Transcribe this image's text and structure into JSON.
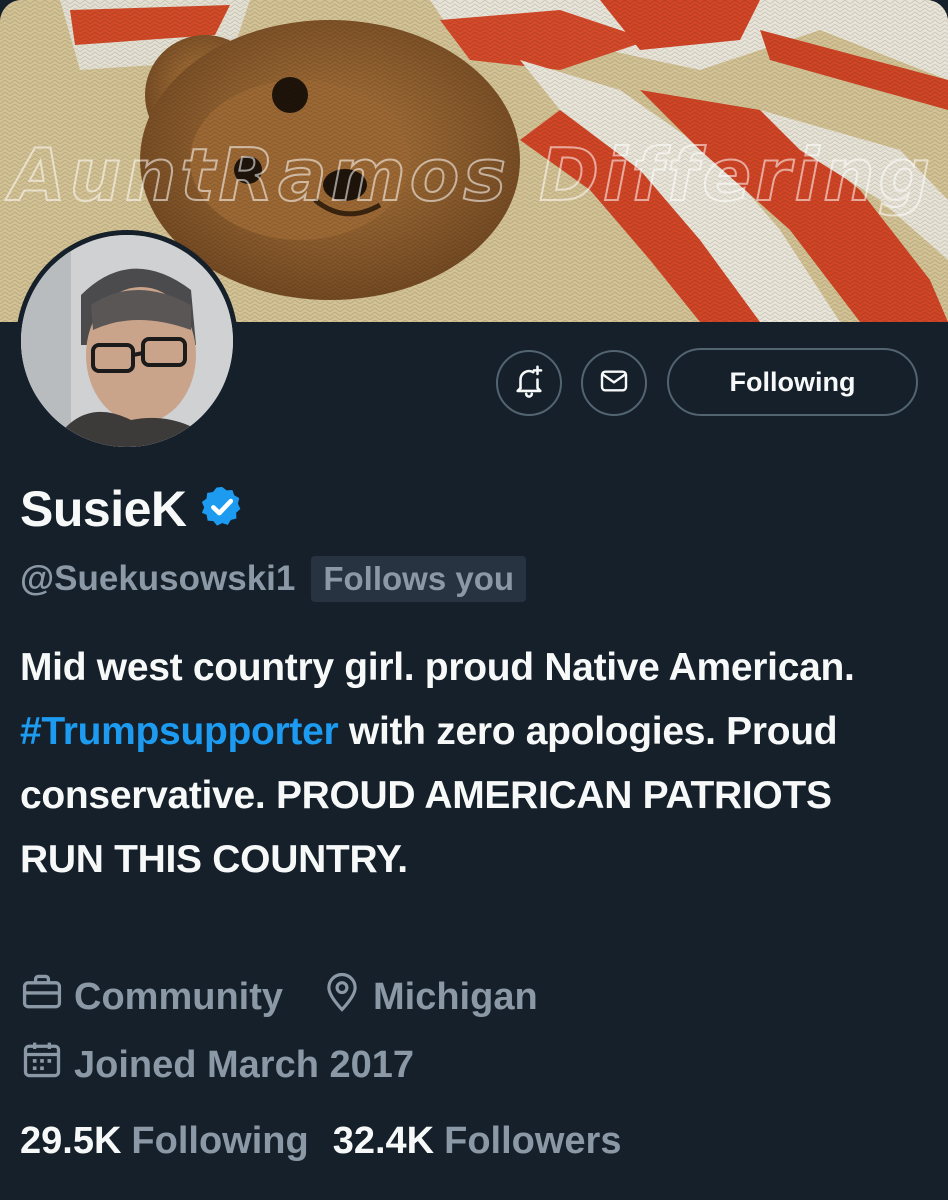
{
  "profile": {
    "display_name": "SusieK",
    "handle": "@Suekusowski1",
    "follows_you_badge": "Follows you",
    "verified": true,
    "bio": {
      "part1": "Mid west country girl. proud Native American.",
      "hashtag": "#Trumpsupporter",
      "part2": "with zero apologies. Proud conservative. PROUD AMERICAN PATRIOTS RUN THIS COUNTRY."
    },
    "category": "Community",
    "location": "Michigan",
    "joined": "Joined March 2017",
    "following_count": "29.5K",
    "following_label": "Following",
    "followers_count": "32.4K",
    "followers_label": "Followers"
  },
  "actions": {
    "following_button": "Following",
    "notify_icon": "bell-plus-icon",
    "message_icon": "envelope-icon"
  },
  "colors": {
    "background": "#15202b",
    "accent": "#1d9bf0",
    "secondary_text": "#8b98a5"
  }
}
